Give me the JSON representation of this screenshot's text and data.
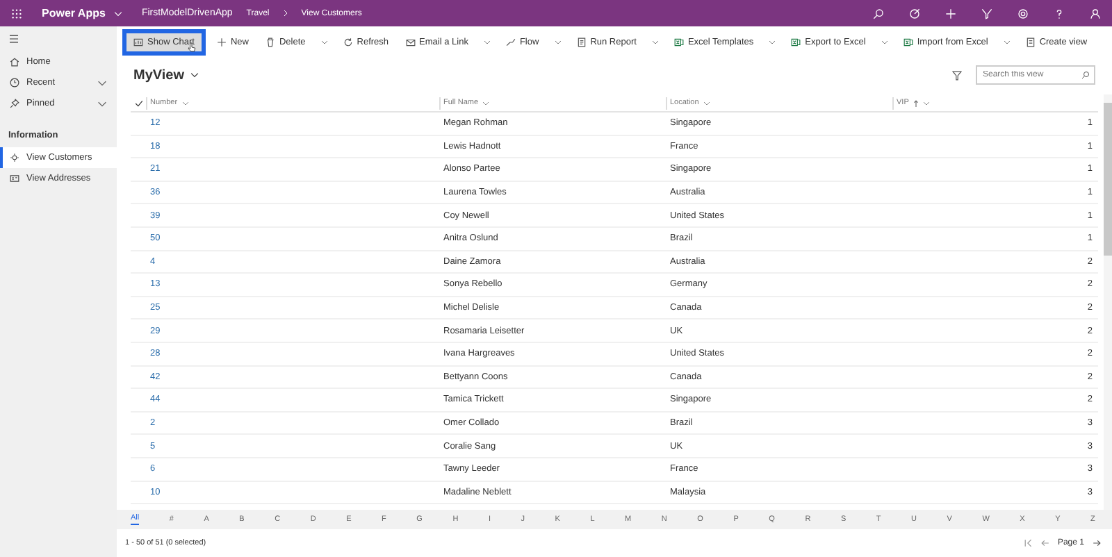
{
  "top_bar": {
    "app_name": "Power Apps",
    "app_title": "FirstModelDrivenApp",
    "breadcrumbs": [
      "Travel",
      "View Customers"
    ]
  },
  "commands": [
    {
      "label": "Show Chart",
      "highlighted": true,
      "dropdown": false
    },
    {
      "label": "New",
      "highlighted": false,
      "dropdown": false
    },
    {
      "label": "Delete",
      "highlighted": false,
      "dropdown": true
    },
    {
      "label": "Refresh",
      "highlighted": false,
      "dropdown": false
    },
    {
      "label": "Email a Link",
      "highlighted": false,
      "dropdown": true
    },
    {
      "label": "Flow",
      "highlighted": false,
      "dropdown": true
    },
    {
      "label": "Run Report",
      "highlighted": false,
      "dropdown": true
    },
    {
      "label": "Excel Templates",
      "highlighted": false,
      "dropdown": true
    },
    {
      "label": "Export to Excel",
      "highlighted": false,
      "dropdown": true
    },
    {
      "label": "Import from Excel",
      "highlighted": false,
      "dropdown": true
    },
    {
      "label": "Create view",
      "highlighted": false,
      "dropdown": false
    }
  ],
  "sidebar": {
    "items": [
      {
        "label": "Home",
        "expandable": false
      },
      {
        "label": "Recent",
        "expandable": true
      },
      {
        "label": "Pinned",
        "expandable": true
      }
    ],
    "section": "Information",
    "entities": [
      {
        "label": "View Customers",
        "selected": true
      },
      {
        "label": "View Addresses",
        "selected": false
      }
    ]
  },
  "view": {
    "title": "MyView",
    "search": {
      "placeholder": "Search this view"
    }
  },
  "table": {
    "columns": [
      "Number",
      "Full Name",
      "Location",
      "VIP"
    ],
    "rows": [
      [
        "12",
        "Megan Rohman",
        "Singapore",
        "1"
      ],
      [
        "18",
        "Lewis Hadnott",
        "France",
        "1"
      ],
      [
        "21",
        "Alonso Partee",
        "Singapore",
        "1"
      ],
      [
        "36",
        "Laurena Towles",
        "Australia",
        "1"
      ],
      [
        "39",
        "Coy Newell",
        "United States",
        "1"
      ],
      [
        "50",
        "Anitra Oslund",
        "Brazil",
        "1"
      ],
      [
        "4",
        "Daine Zamora",
        "Australia",
        "2"
      ],
      [
        "13",
        "Sonya Rebello",
        "Germany",
        "2"
      ],
      [
        "25",
        "Michel Delisle",
        "Canada",
        "2"
      ],
      [
        "29",
        "Rosamaria Leisetter",
        "UK",
        "2"
      ],
      [
        "28",
        "Ivana Hargreaves",
        "United States",
        "2"
      ],
      [
        "42",
        "Bettyann Coons",
        "Canada",
        "2"
      ],
      [
        "44",
        "Tamica Trickett",
        "Singapore",
        "2"
      ],
      [
        "2",
        "Omer Collado",
        "Brazil",
        "3"
      ],
      [
        "5",
        "Coralie Sang",
        "UK",
        "3"
      ],
      [
        "6",
        "Tawny Leeder",
        "France",
        "3"
      ],
      [
        "10",
        "Madaline Neblett",
        "Malaysia",
        "3"
      ]
    ]
  },
  "alphabet": [
    {
      "label": "All",
      "selected": true
    },
    {
      "label": "#",
      "selected": false
    },
    {
      "label": "A",
      "selected": false
    },
    {
      "label": "B",
      "selected": false
    },
    {
      "label": "C",
      "selected": false
    },
    {
      "label": "D",
      "selected": false
    },
    {
      "label": "E",
      "selected": false
    },
    {
      "label": "F",
      "selected": false
    },
    {
      "label": "G",
      "selected": false
    },
    {
      "label": "H",
      "selected": false
    },
    {
      "label": "I",
      "selected": false
    },
    {
      "label": "J",
      "selected": false
    },
    {
      "label": "K",
      "selected": false
    },
    {
      "label": "L",
      "selected": false
    },
    {
      "label": "M",
      "selected": false
    },
    {
      "label": "N",
      "selected": false
    },
    {
      "label": "O",
      "selected": false
    },
    {
      "label": "P",
      "selected": false
    },
    {
      "label": "Q",
      "selected": false
    },
    {
      "label": "R",
      "selected": false
    },
    {
      "label": "S",
      "selected": false
    },
    {
      "label": "T",
      "selected": false
    },
    {
      "label": "U",
      "selected": false
    },
    {
      "label": "V",
      "selected": false
    },
    {
      "label": "W",
      "selected": false
    },
    {
      "label": "X",
      "selected": false
    },
    {
      "label": "Y",
      "selected": false
    },
    {
      "label": "Z",
      "selected": false
    }
  ],
  "status": {
    "count": "1 - 50 of 51 (0 selected)",
    "page": "Page 1"
  }
}
